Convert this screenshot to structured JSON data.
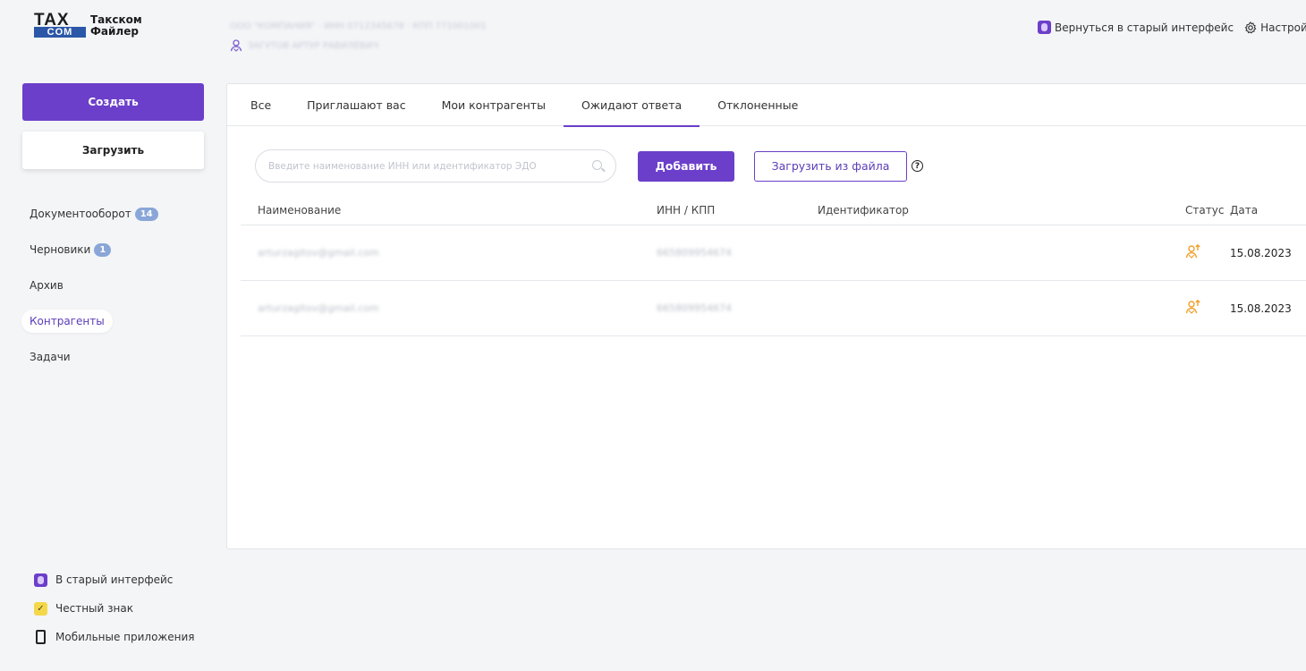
{
  "brand": {
    "logo_tax": "TAX",
    "logo_com": "COM",
    "line1": "Такском",
    "line2": "Файлер"
  },
  "org": {
    "info": "ООО \"КОМПАНИЯ\" · ИНН 0712345678 · КПП 771001001",
    "user": "ЗАГУТОВ АРТУР РАВИЛЕВИЧ"
  },
  "header": {
    "old_ui_link": "Вернуться в старый интерфейс",
    "settings_link": "Настройки"
  },
  "sidebar": {
    "create_label": "Создать",
    "upload_label": "Загрузить",
    "items": [
      {
        "label": "Документооборот",
        "badge": "14"
      },
      {
        "label": "Черновики",
        "badge": "1"
      },
      {
        "label": "Архив"
      },
      {
        "label": "Контрагенты",
        "active": true
      },
      {
        "label": "Задачи"
      }
    ],
    "bottom": [
      {
        "label": "В старый интерфейс",
        "icon": "old-interface-icon"
      },
      {
        "label": "Честный знак",
        "icon": "chestny-znak-icon"
      },
      {
        "label": "Мобильные приложения",
        "icon": "mobile-phone-icon"
      }
    ]
  },
  "tabs": [
    {
      "label": "Все"
    },
    {
      "label": "Приглашают вас"
    },
    {
      "label": "Мои контрагенты"
    },
    {
      "label": "Ожидают ответа",
      "active": true
    },
    {
      "label": "Отклоненные"
    }
  ],
  "toolbar": {
    "search_placeholder": "Введите наименование ИНН или идентификатор ЭДО",
    "add_label": "Добавить",
    "file_label": "Загрузить из файла",
    "help_glyph": "?"
  },
  "table": {
    "headers": {
      "name": "Наименование",
      "inn": "ИНН / КПП",
      "id": "Идентификатор",
      "status": "Статус",
      "date": "Дата"
    },
    "rows": [
      {
        "name": "arturzagitov@gmail.com",
        "inn": "665809954674",
        "id": "",
        "date": "15.08.2023"
      },
      {
        "name": "arturzagitov@gmail.com",
        "inn": "665809954674",
        "id": "",
        "date": "15.08.2023"
      }
    ]
  },
  "colors": {
    "accent": "#6b3fc9",
    "badge": "#8aa6d8",
    "status_orange": "#f0a02c",
    "logo_blue": "#2c57a8"
  }
}
